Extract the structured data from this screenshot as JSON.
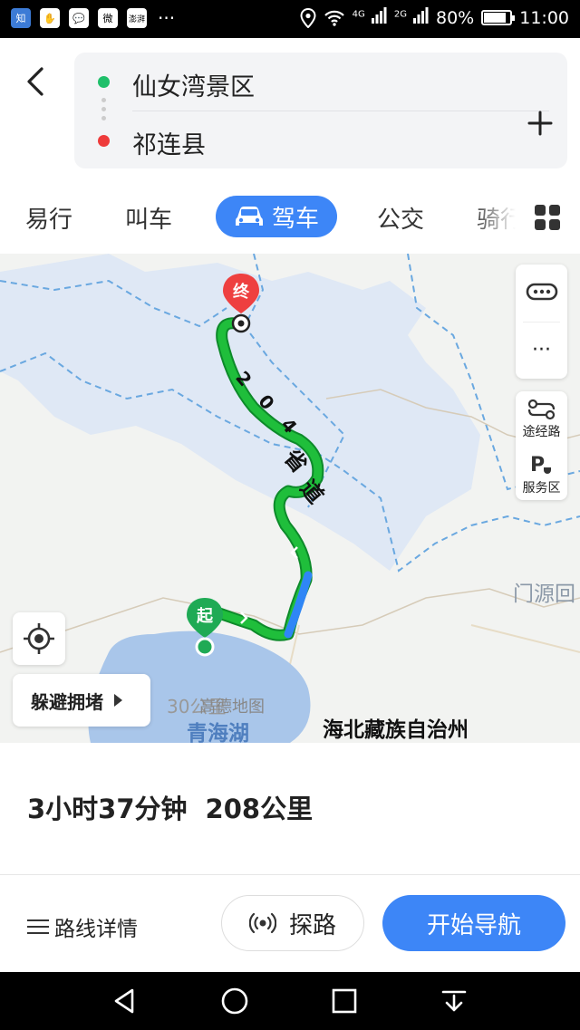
{
  "status_bar": {
    "apps": [
      "知",
      "✋",
      "💬",
      "微",
      "澎湃"
    ],
    "more": "···",
    "network_4g": "4G",
    "network_2g": "2G",
    "battery": "80%",
    "time": "11:00"
  },
  "route": {
    "origin": "仙女湾景区",
    "destination": "祁连县"
  },
  "tabs": [
    {
      "label": "易行"
    },
    {
      "label": "叫车"
    },
    {
      "label": "驾车",
      "active": true
    },
    {
      "label": "公交"
    },
    {
      "label": "骑行"
    }
  ],
  "map": {
    "road_label_chars": [
      "2",
      "0",
      "4",
      "省",
      "道"
    ],
    "start_marker": "起",
    "end_marker": "终",
    "panel_more": "···",
    "waypoint_label": "途经路",
    "service_area_label": "服务区",
    "avoid_congestion": "躲避拥堵",
    "scale": "30公里",
    "watermark": "高德地图",
    "lake_label": "青海湖",
    "region_label": "海北藏族自治州",
    "town_label": "门源回",
    "colors": {
      "route_green": "#1fbe3b",
      "route_blue": "#2f86f6",
      "water": "#dfe8f5",
      "lake": "#a9c6ea"
    }
  },
  "summary": {
    "duration": "3小时37分钟",
    "distance": "208公里"
  },
  "actions": {
    "route_details": "路线详情",
    "explore": "探路",
    "start_navigation": "开始导航"
  }
}
